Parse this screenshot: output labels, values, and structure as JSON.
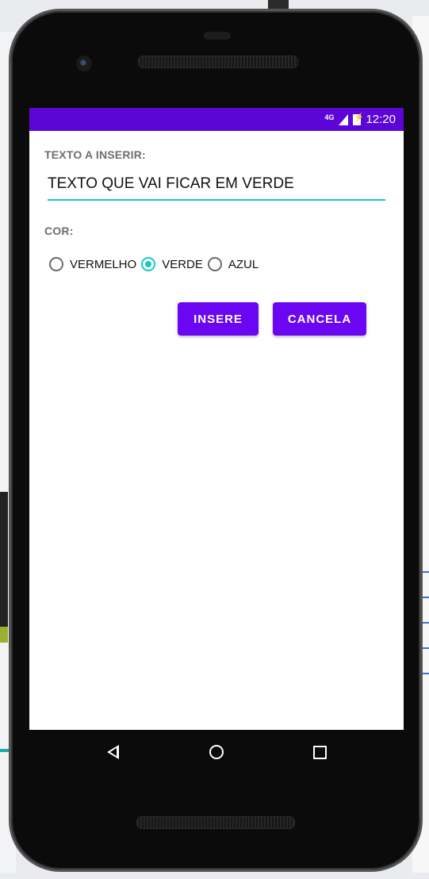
{
  "status_bar": {
    "network": "4G",
    "time": "12:20",
    "background_color": "#5b06d6"
  },
  "form": {
    "text_label": "TEXTO A INSERIR:",
    "text_value": "TEXTO QUE VAI FICAR EM VERDE",
    "color_label": "COR:",
    "radios": [
      {
        "label": "VERMELHO",
        "checked": false
      },
      {
        "label": "VERDE",
        "checked": true
      },
      {
        "label": "AZUL",
        "checked": false
      }
    ],
    "accent_color": "#17c9c2"
  },
  "buttons": {
    "insert_label": "INSERE",
    "cancel_label": "CANCELA",
    "color": "#6b06f2"
  },
  "nav_bar": {
    "back_icon": "back-triangle-icon",
    "home_icon": "home-circle-icon",
    "recents_icon": "recents-square-icon"
  }
}
